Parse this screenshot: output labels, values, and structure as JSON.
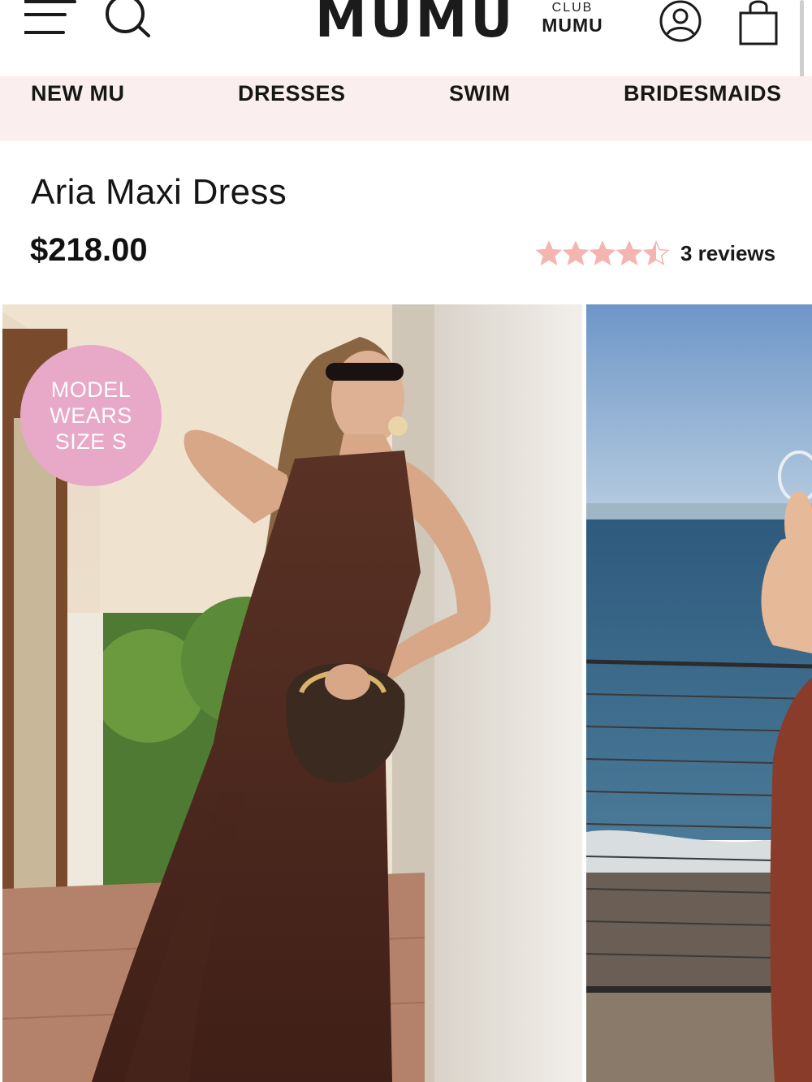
{
  "brand": {
    "logo": "MUMU",
    "club_top": "CLUB",
    "club_bottom": "MUMU"
  },
  "icons": {
    "menu": "hamburger-menu-icon",
    "search": "search-icon",
    "account": "user-account-icon",
    "bag": "shopping-bag-icon"
  },
  "nav": {
    "items": [
      {
        "label": "NEW MU"
      },
      {
        "label": "DRESSES"
      },
      {
        "label": "SWIM"
      },
      {
        "label": "BRIDESMAIDS"
      }
    ]
  },
  "product": {
    "title": "Aria Maxi Dress",
    "price": "$218.00",
    "rating": {
      "value": 4.5,
      "max": 5,
      "reviews_label": "3 reviews"
    }
  },
  "gallery": {
    "badge": {
      "line1": "MODEL",
      "line2": "WEARS",
      "line3": "SIZE S"
    }
  },
  "colors": {
    "nav_background": "#fbeeee",
    "star": "#f4b5b0",
    "badge": "#e8a8c8",
    "text": "#111111"
  }
}
